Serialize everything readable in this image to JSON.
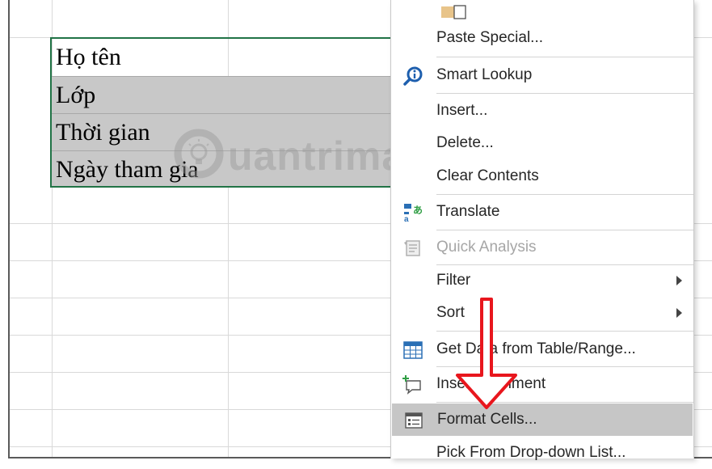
{
  "sheet": {
    "cells": [
      "Họ tên",
      "Lớp",
      "Thời gian",
      "Ngày tham gia"
    ]
  },
  "watermark": {
    "text": "uantrimang",
    "icon": "lightbulb-q-icon"
  },
  "context_menu": {
    "top_icon": "paste-options-icon",
    "items": [
      {
        "label": "Paste Special...",
        "icon": null,
        "disabled": false,
        "submenu": false
      },
      {
        "label": "Smart Lookup",
        "icon": "smart-lookup-icon",
        "disabled": false,
        "submenu": false
      },
      {
        "label": "Insert...",
        "icon": null,
        "disabled": false,
        "submenu": false
      },
      {
        "label": "Delete...",
        "icon": null,
        "disabled": false,
        "submenu": false
      },
      {
        "label": "Clear Contents",
        "icon": null,
        "disabled": false,
        "submenu": false
      },
      {
        "label": "Translate",
        "icon": "translate-icon",
        "disabled": false,
        "submenu": false
      },
      {
        "label": "Quick Analysis",
        "icon": "quick-analysis-icon",
        "disabled": true,
        "submenu": false
      },
      {
        "label": "Filter",
        "icon": null,
        "disabled": false,
        "submenu": true
      },
      {
        "label": "Sort",
        "icon": null,
        "disabled": false,
        "submenu": true
      },
      {
        "label": "Get Data from Table/Range...",
        "icon": "table-icon",
        "disabled": false,
        "submenu": false
      },
      {
        "label": "Insert Comment",
        "icon": "comment-icon",
        "disabled": false,
        "submenu": false
      },
      {
        "label": "Format Cells...",
        "icon": "format-cells-icon",
        "disabled": false,
        "submenu": false,
        "highlighted": true
      },
      {
        "label": "Pick From Drop-down List...",
        "icon": null,
        "disabled": false,
        "submenu": false
      }
    ]
  },
  "colors": {
    "selection_border": "#217346",
    "cell_shade": "#c8c8c8",
    "menu_highlight": "#c6c6c6",
    "annotation_arrow": "#e8161d",
    "smart_lookup_icon": "#1e5fae"
  }
}
